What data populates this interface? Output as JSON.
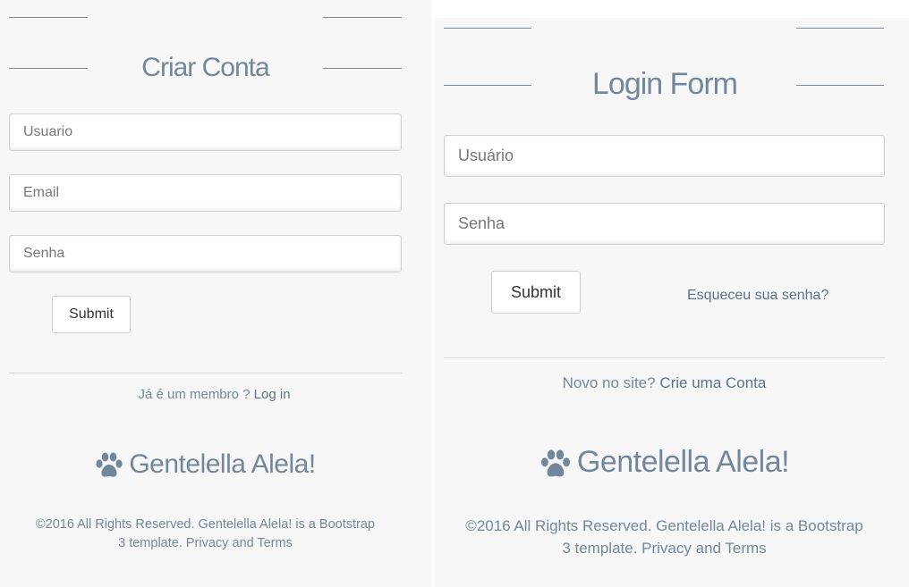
{
  "register": {
    "title": "Criar Conta",
    "username_placeholder": "Usuario",
    "email_placeholder": "Email",
    "password_placeholder": "Senha",
    "submit_label": "Submit",
    "member_prompt": "Já é um membro ?",
    "login_link": "Log in",
    "brand_name": "Gentelella Alela!",
    "footer_line1": "©2016 All Rights Reserved. Gentelella Alela! is a Bootstrap",
    "footer_line2": "3 template. Privacy and Terms"
  },
  "login": {
    "title": "Login Form",
    "username_placeholder": "Usuário",
    "password_placeholder": "Senha",
    "submit_label": "Submit",
    "forgot_link": "Esqueceu sua senha?",
    "new_prompt": "Novo no site?",
    "create_link": "Crie uma Conta",
    "brand_name": "Gentelella Alela!",
    "footer_line1": "©2016 All Rights Reserved. Gentelella Alela! is a Bootstrap",
    "footer_line2": "3 template. Privacy and Terms"
  },
  "colors": {
    "background": "#F7F7F7",
    "text": "#73879C",
    "link": "#5A738E"
  },
  "icons": {
    "brand": "paw-icon"
  }
}
